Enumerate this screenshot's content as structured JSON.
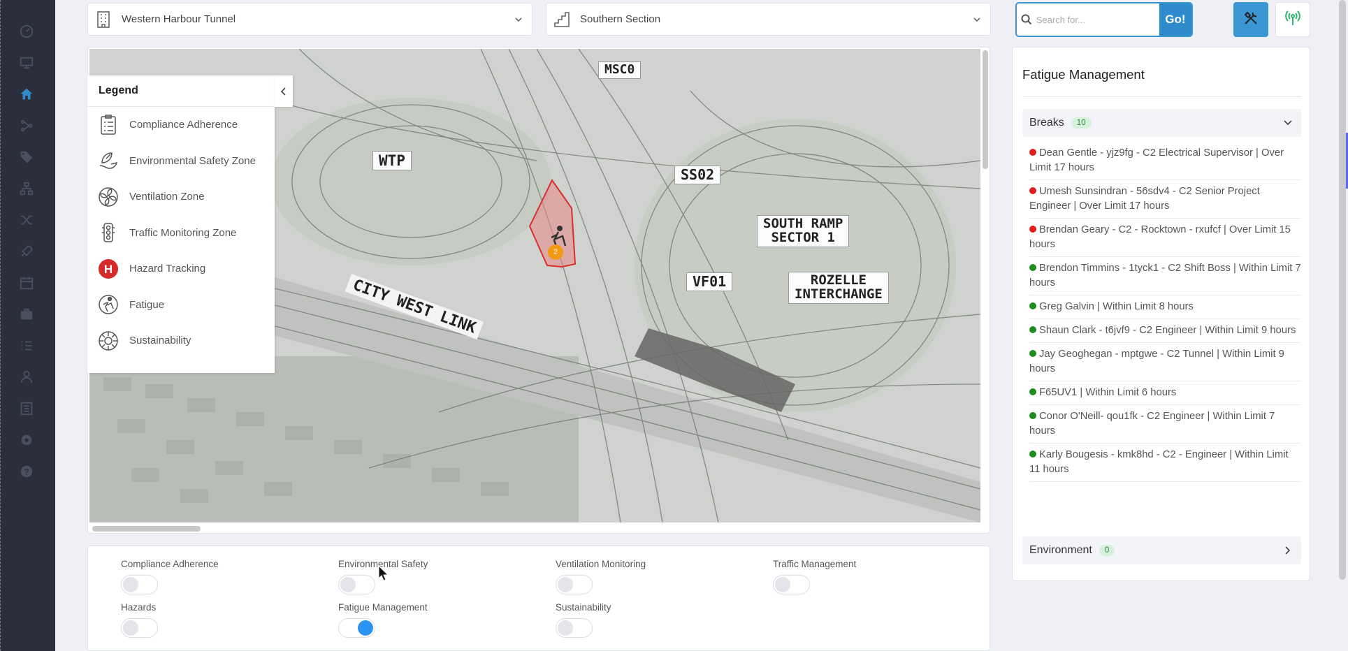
{
  "sidebar": {
    "icons": [
      "dashboard-icon",
      "monitor-icon",
      "home-icon",
      "flow-icon",
      "tags-icon",
      "org-chart-icon",
      "shuffle-icon",
      "rocket-icon",
      "calendar-icon",
      "briefcase-icon",
      "checklist-icon",
      "worker-icon",
      "list-icon",
      "settings-icon",
      "help-icon"
    ],
    "active": "home-icon",
    "bg": "#2b2f3b",
    "active_color": "#2f8ccc"
  },
  "header": {
    "project_selector": "Western Harbour Tunnel",
    "section_selector": "Southern Section",
    "search_placeholder": "Search for...",
    "go_label": "Go!"
  },
  "map": {
    "labels": {
      "msc0": "MSC0",
      "wtp": "WTP",
      "ss02": "SS02",
      "south_ramp_l1": "SOUTH RAMP",
      "south_ramp_l2": "SECTOR 1",
      "vf01": "VF01",
      "rozelle_l1": "ROZELLE",
      "rozelle_l2": "INTERCHANGE",
      "city_west_link": "CITY WEST LINK"
    },
    "marker_count": "2"
  },
  "legend": {
    "title": "Legend",
    "items": [
      {
        "label": "Compliance Adherence",
        "icon": "compliance-icon"
      },
      {
        "label": "Environmental Safety Zone",
        "icon": "environment-icon"
      },
      {
        "label": "Ventilation Zone",
        "icon": "fan-icon"
      },
      {
        "label": "Traffic Monitoring Zone",
        "icon": "traffic-light-icon"
      },
      {
        "label": "Hazard Tracking",
        "icon": "hazard-icon"
      },
      {
        "label": "Fatigue",
        "icon": "fatigue-icon"
      },
      {
        "label": "Sustainability",
        "icon": "sustainability-icon"
      }
    ]
  },
  "toggles": [
    {
      "label": "Compliance Adherence",
      "on": false
    },
    {
      "label": "Environmental Safety",
      "on": false
    },
    {
      "label": "Ventilation Monitoring",
      "on": false
    },
    {
      "label": "Traffic Management",
      "on": false
    },
    {
      "label": "Hazards",
      "on": false
    },
    {
      "label": "Fatigue Management",
      "on": true
    },
    {
      "label": "Sustainability",
      "on": false
    }
  ],
  "fatigue": {
    "title": "Fatigue Management",
    "breaks": {
      "label": "Breaks",
      "count": "10",
      "items": [
        {
          "status": "red",
          "text": "Dean Gentle - yjz9fg - C2 Electrical Supervisor | Over Limit 17 hours"
        },
        {
          "status": "red",
          "text": "Umesh Sunsindran - 56sdv4 - C2 Senior Project Engineer | Over Limit 17 hours"
        },
        {
          "status": "red",
          "text": "Brendan Geary - C2 - Rocktown - rxufcf | Over Limit 15 hours"
        },
        {
          "status": "green",
          "text": "Brendon Timmins - 1tyck1 - C2 Shift Boss | Within Limit 7 hours"
        },
        {
          "status": "green",
          "text": "Greg Galvin | Within Limit 8 hours"
        },
        {
          "status": "green",
          "text": "Shaun Clark - t6jvf9 - C2 Engineer | Within Limit 9 hours"
        },
        {
          "status": "green",
          "text": "Jay Geoghegan - mptgwe - C2 Tunnel | Within Limit 9 hours"
        },
        {
          "status": "green",
          "text": "F65UV1 | Within Limit 6 hours"
        },
        {
          "status": "green",
          "text": "Conor O'Neill- qou1fk - C2 Engineer | Within Limit 7 hours"
        },
        {
          "status": "green",
          "text": "Karly Bougesis - kmk8hd - C2 - Engineer | Within Limit 11 hours"
        }
      ]
    },
    "environment": {
      "label": "Environment",
      "count": "0"
    }
  },
  "colors": {
    "accent": "#2f8ccc",
    "over_limit": "#e01e1e",
    "within_limit": "#1e8c1e",
    "toggle_on": "#2b93f0"
  }
}
